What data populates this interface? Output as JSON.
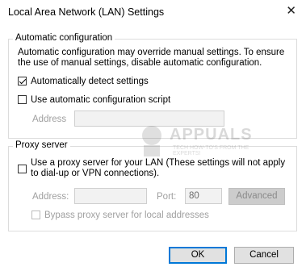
{
  "window": {
    "title": "Local Area Network (LAN) Settings",
    "close_glyph": "✕"
  },
  "auto_config": {
    "legend": "Automatic configuration",
    "description": "Automatic configuration may override manual settings.  To ensure the use of manual settings, disable automatic configuration.",
    "auto_detect": {
      "label": "Automatically detect settings",
      "checked": true
    },
    "use_script": {
      "label": "Use automatic configuration script",
      "checked": false
    },
    "address_label": "Address",
    "address_value": ""
  },
  "proxy": {
    "legend": "Proxy server",
    "use_proxy": {
      "label": "Use a proxy server for your LAN (These settings will not apply to dial-up or VPN connections).",
      "checked": false
    },
    "address_label": "Address:",
    "address_value": "",
    "port_label": "Port:",
    "port_value": "80",
    "advanced_label": "Advanced",
    "bypass": {
      "label": "Bypass proxy server for local addresses",
      "checked": false
    }
  },
  "footer": {
    "ok_label": "OK",
    "cancel_label": "Cancel"
  },
  "watermark": {
    "text": "APPUALS",
    "subtext": "TECH HOW-TO'S FROM THE EXPERTS!"
  }
}
